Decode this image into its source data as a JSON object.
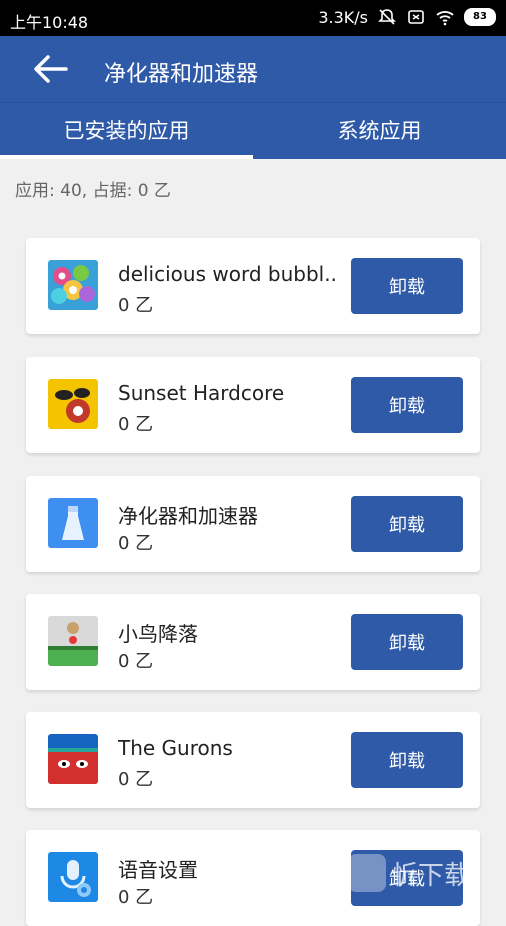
{
  "statusbar": {
    "time": "上午10:48",
    "network_speed": "3.3K/s",
    "battery": "83"
  },
  "appbar": {
    "back_icon": "back-arrow-icon",
    "title": "净化器和加速器"
  },
  "tabs": [
    {
      "label": "已安装的应用",
      "selected": true
    },
    {
      "label": "系统应用",
      "selected": false
    }
  ],
  "summary": "应用: 40, 占据: 0 乙",
  "apps": [
    {
      "name": "delicious word bubbl..",
      "size": "0 乙",
      "button": "卸载",
      "icon": "bubble-balls-icon"
    },
    {
      "name": "Sunset Hardcore",
      "size": "0 乙",
      "button": "卸载",
      "icon": "sunset-hardcore-icon"
    },
    {
      "name": "净化器和加速器",
      "size": "0 乙",
      "button": "卸载",
      "icon": "broom-icon"
    },
    {
      "name": "小鸟降落",
      "size": "0 乙",
      "button": "卸载",
      "icon": "bird-landing-icon"
    },
    {
      "name": "The Gurons",
      "size": "0 乙",
      "button": "卸载",
      "icon": "gurons-icon"
    },
    {
      "name": "语音设置",
      "size": "0 乙",
      "button": "卸载",
      "icon": "voice-settings-icon"
    }
  ],
  "watermark": "忻下载",
  "colors": {
    "primary": "#2f5aa8",
    "background": "#f0f0f0"
  }
}
